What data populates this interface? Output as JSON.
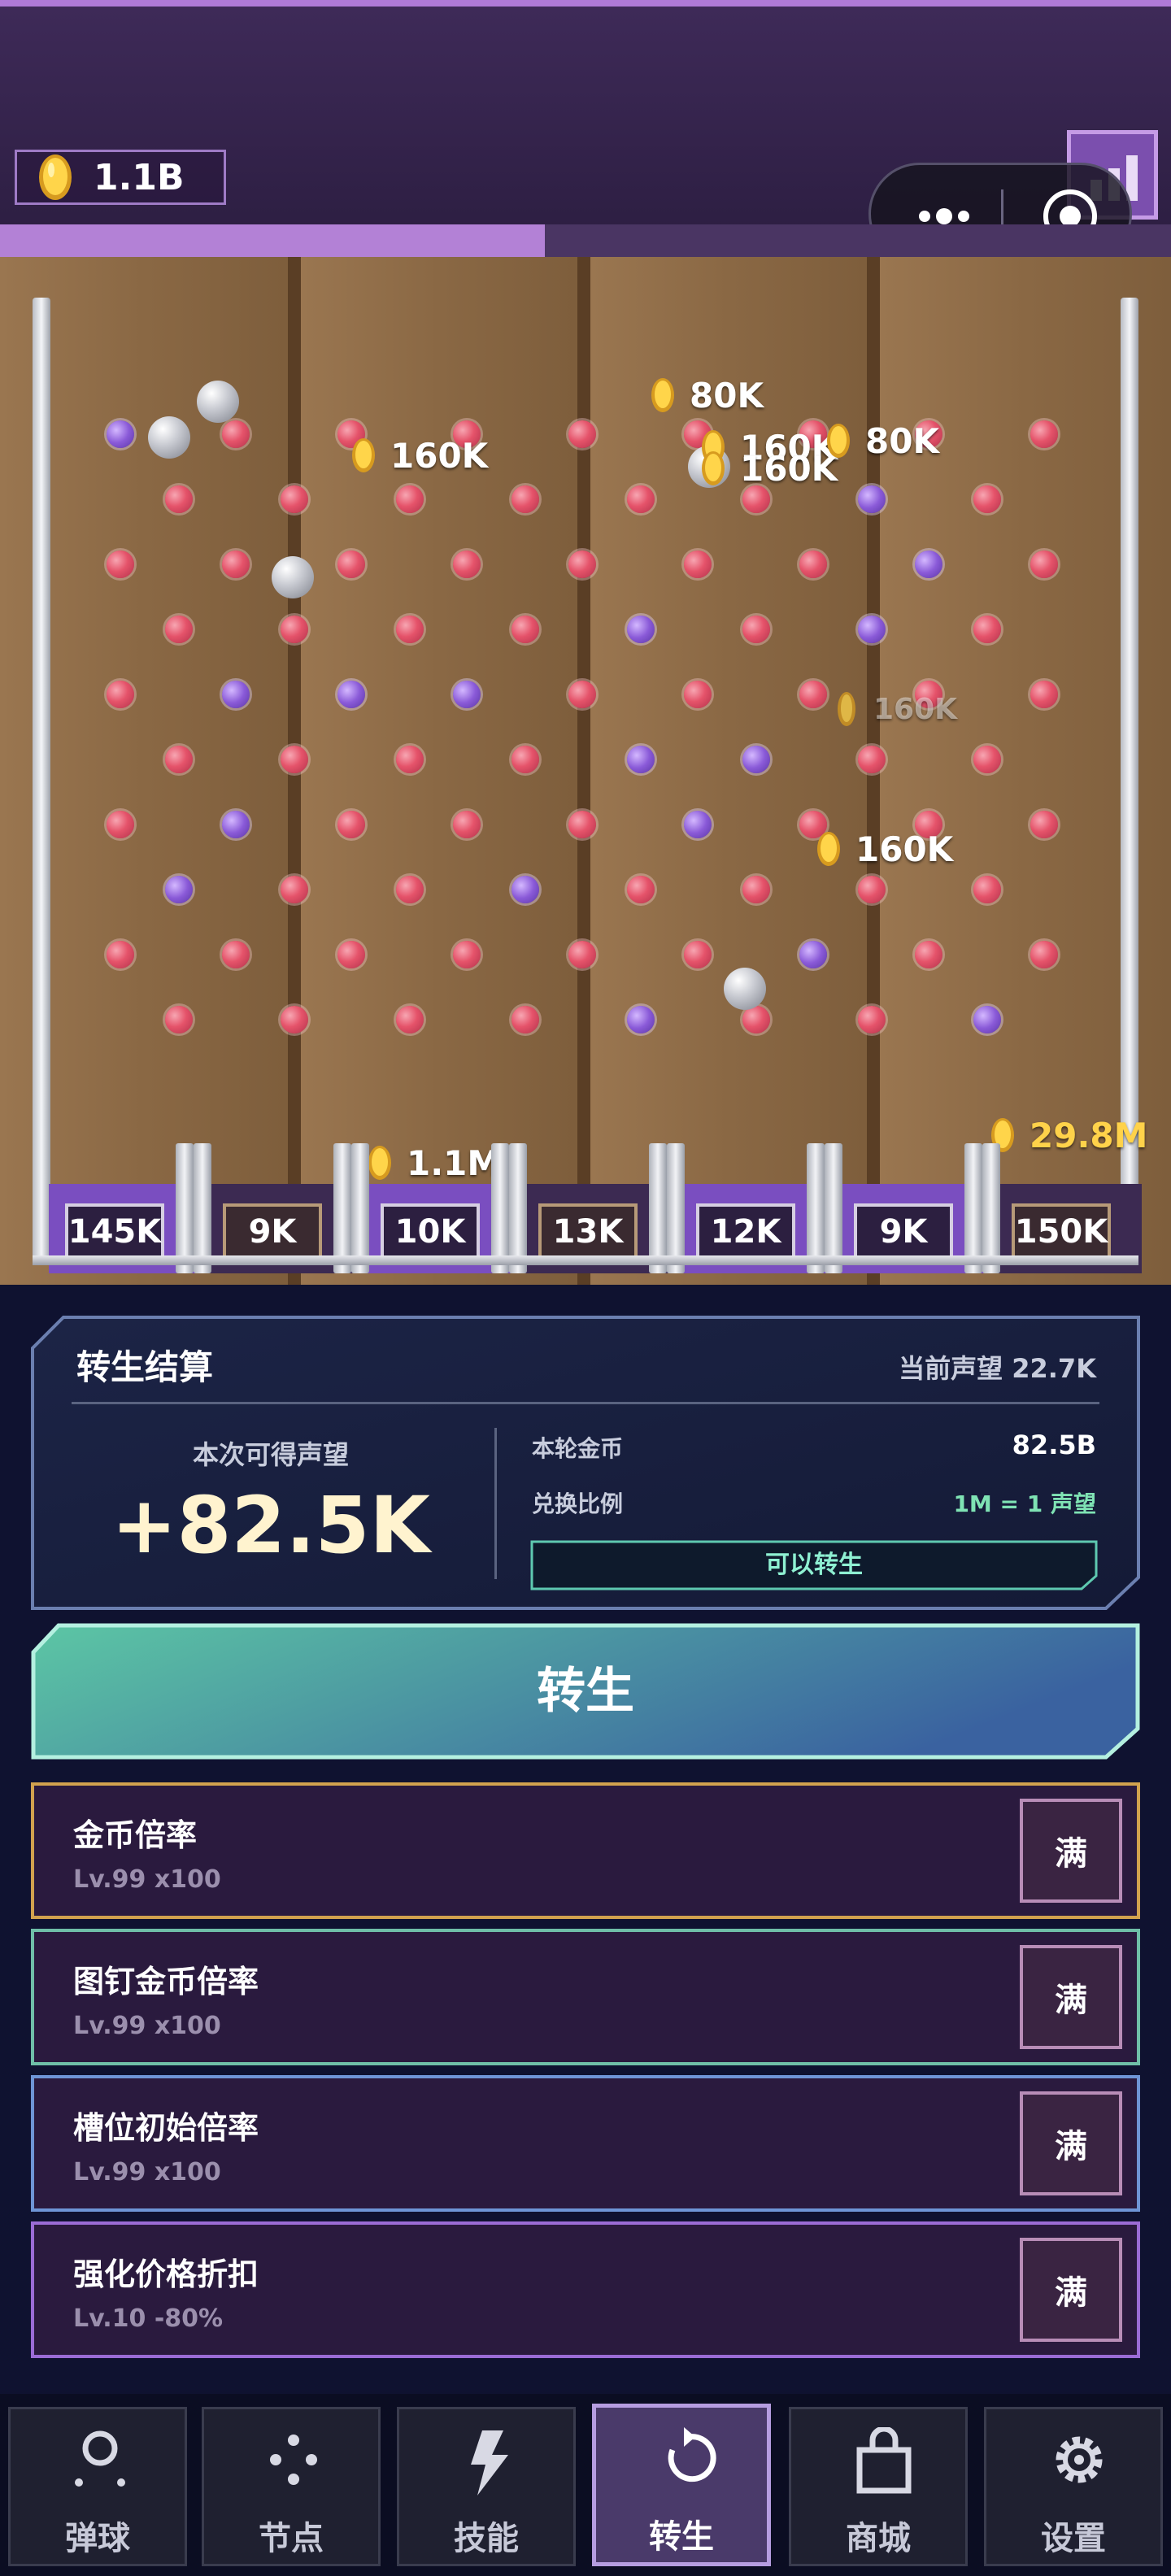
{
  "header": {
    "coins": "1.1B",
    "progress_fraction": 0.465
  },
  "board": {
    "popups": [
      "80K",
      "160K",
      "160K",
      "160K",
      "80K",
      "160K",
      "160K",
      "1.1M",
      "29.8M"
    ],
    "slots": [
      "145K",
      "9K",
      "10K",
      "13K",
      "12K",
      "9K",
      "150K"
    ]
  },
  "rebirth_panel": {
    "title": "转生结算",
    "current_reputation": "当前声望  22.7K",
    "gain_label": "本次可得声望",
    "gain_value": "+82.5K",
    "round_coins_label": "本轮金币",
    "round_coins_value": "82.5B",
    "ratio_label": "兑换比例",
    "ratio_value": "1M = 1 声望",
    "status": "可以转生"
  },
  "rebirth_button": "转生",
  "upgrades": [
    {
      "name": "金币倍率",
      "level": "Lv.99  x100",
      "action": "满"
    },
    {
      "name": "图钉金币倍率",
      "level": "Lv.99  x100",
      "action": "满"
    },
    {
      "name": "槽位初始倍率",
      "level": "Lv.99  x100",
      "action": "满"
    },
    {
      "name": "强化价格折扣",
      "level": "Lv.10  -80%",
      "action": "满"
    }
  ],
  "nav": [
    {
      "label": "弹球",
      "icon": "pinball-icon"
    },
    {
      "label": "节点",
      "icon": "nodes-icon"
    },
    {
      "label": "技能",
      "icon": "lightning-icon"
    },
    {
      "label": "转生",
      "icon": "rebirth-icon",
      "active": true
    },
    {
      "label": "商城",
      "icon": "shop-bag-icon"
    },
    {
      "label": "设置",
      "icon": "gear-icon"
    }
  ],
  "colors": {
    "upgrade_borders": [
      "#d2a24e",
      "#6fbfa8",
      "#6e95d6",
      "#9b6cd6"
    ],
    "accent_purple": "#7a4ec0",
    "rebirth_button_gradient": [
      "#5cc6a4",
      "#3a62a0"
    ]
  }
}
